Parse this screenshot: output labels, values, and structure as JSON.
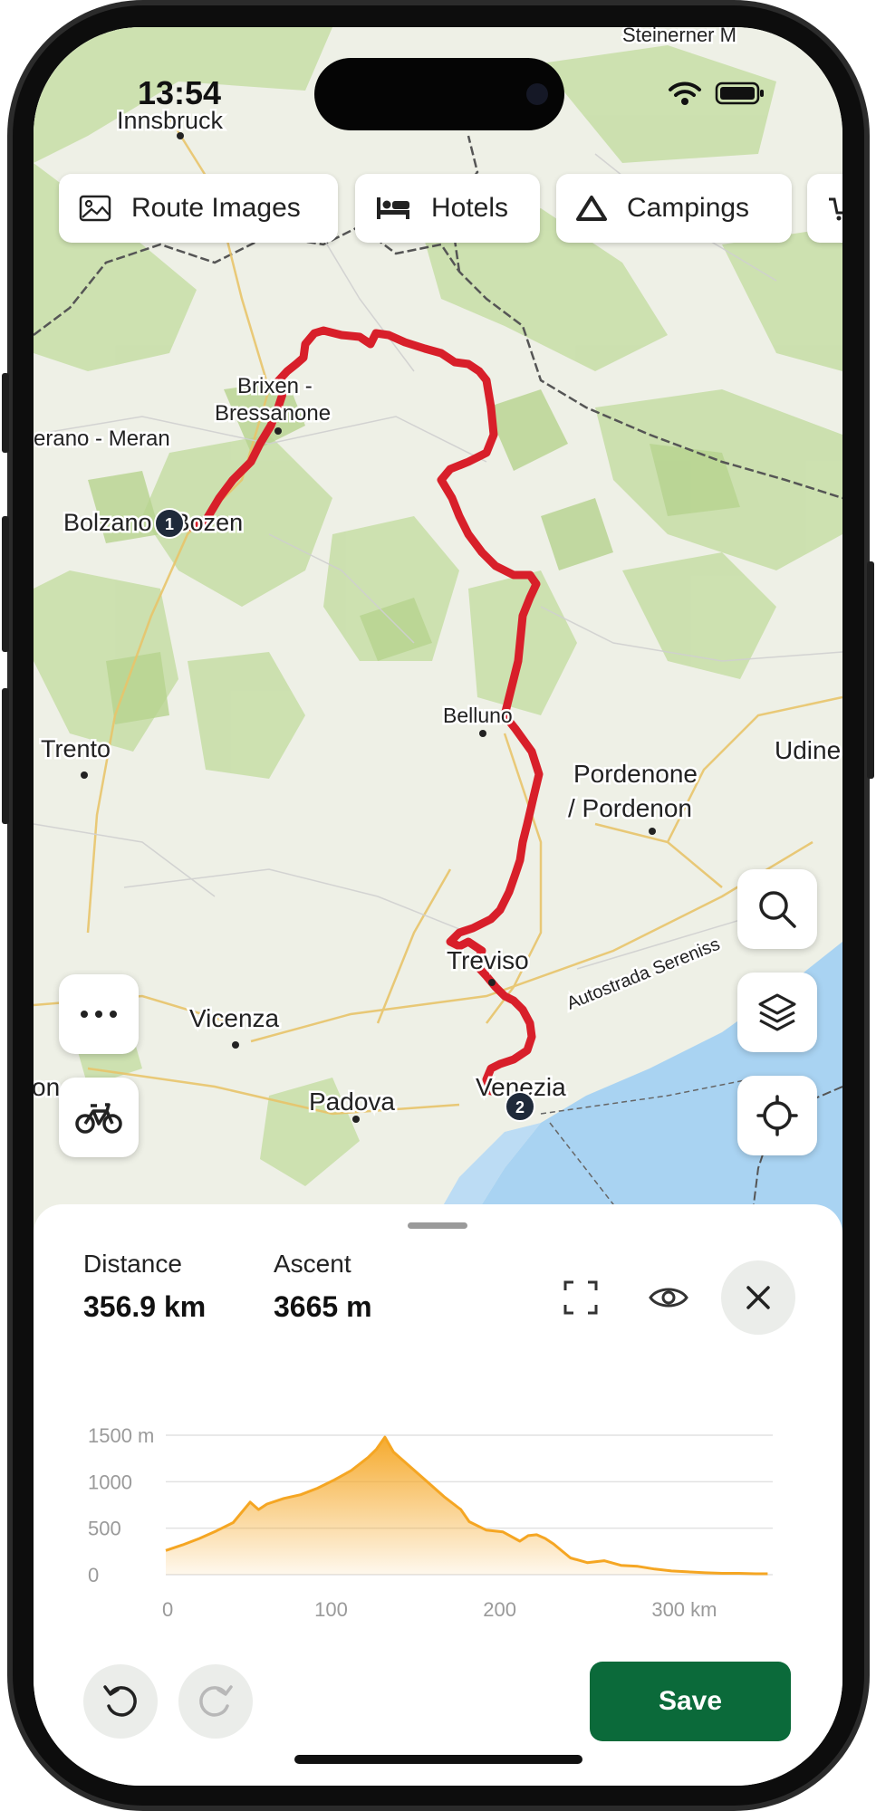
{
  "status_bar": {
    "time": "13:54"
  },
  "chips": [
    {
      "label": "Route Images",
      "icon": "image-icon"
    },
    {
      "label": "Hotels",
      "icon": "bed-icon"
    },
    {
      "label": "Campings",
      "icon": "tent-icon"
    }
  ],
  "map": {
    "places": {
      "innsbruck": "Innsbruck",
      "steinernes_meer": "Steinerner M",
      "brixen": "Brixen -",
      "bressanone": "Bressanone",
      "merano": "erano - Meran",
      "bolzano": "Bolzano - Bozen",
      "trento": "Trento",
      "belluno": "Belluno",
      "pordenone1": "Pordenone",
      "pordenone2": "/ Pordenon",
      "udine": "Udine",
      "treviso": "Treviso",
      "vicenza": "Vicenza",
      "padova": "Padova",
      "venezia": "Venezia",
      "verona": "on",
      "autostrada": "Autostrada Sereniss"
    },
    "markers": {
      "start": "1",
      "end": "2"
    },
    "route_color": "#d81f2a"
  },
  "controls": {
    "more": "more-icon",
    "profile": "bicycle-icon",
    "search": "search-icon",
    "layers": "layers-icon",
    "locate": "locate-icon"
  },
  "stats": {
    "distance_label": "Distance",
    "distance_value": "356.9 km",
    "ascent_label": "Ascent",
    "ascent_value": "3665 m"
  },
  "chart_data": {
    "type": "area",
    "title": "",
    "xlabel": "",
    "ylabel": "",
    "x_unit": "km",
    "y_unit": "m",
    "xlim": [
      0,
      360
    ],
    "ylim": [
      0,
      1500
    ],
    "x_ticks": [
      "0",
      "100",
      "200",
      "300 km"
    ],
    "y_ticks": [
      "1500 m",
      "1000",
      "500",
      "0"
    ],
    "color": "#f5a623",
    "x": [
      0,
      10,
      20,
      30,
      40,
      50,
      55,
      60,
      70,
      80,
      90,
      100,
      110,
      120,
      125,
      130,
      135,
      145,
      155,
      165,
      175,
      180,
      190,
      200,
      210,
      215,
      220,
      225,
      230,
      240,
      250,
      260,
      270,
      280,
      290,
      300,
      310,
      320,
      330,
      340,
      350,
      357
    ],
    "y": [
      260,
      320,
      390,
      470,
      560,
      780,
      700,
      760,
      820,
      860,
      930,
      1020,
      1120,
      1260,
      1350,
      1480,
      1320,
      1160,
      1000,
      840,
      700,
      570,
      480,
      460,
      360,
      420,
      430,
      390,
      330,
      180,
      130,
      150,
      100,
      90,
      60,
      40,
      30,
      20,
      15,
      15,
      10,
      10
    ]
  },
  "actions": {
    "undo": "undo-icon",
    "redo": "redo-icon",
    "save_label": "Save"
  }
}
